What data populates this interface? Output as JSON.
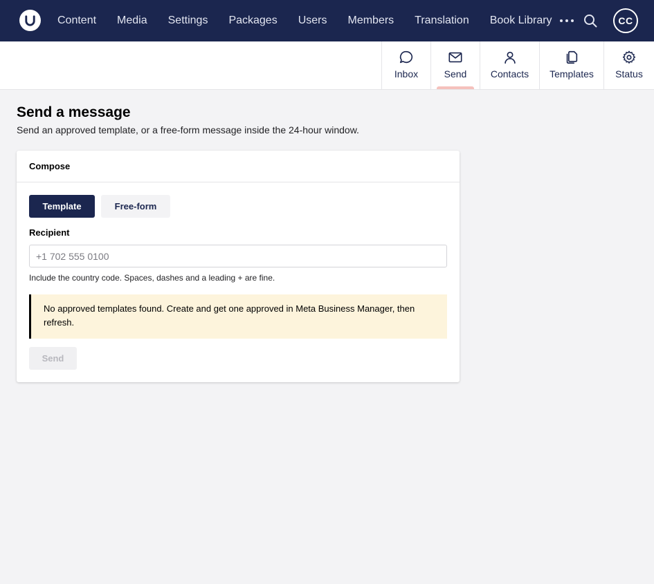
{
  "topnav": {
    "items": [
      "Content",
      "Media",
      "Settings",
      "Packages",
      "Users",
      "Members",
      "Translation",
      "Book Library"
    ],
    "avatar_initials": "CC",
    "icons": {
      "more": "ellipsis-icon",
      "search": "search-icon",
      "logo": "umbraco-logo-icon"
    }
  },
  "subtabs": [
    {
      "label": "Inbox",
      "icon": "chat-bubble-icon"
    },
    {
      "label": "Send",
      "icon": "envelope-icon",
      "active": true
    },
    {
      "label": "Contacts",
      "icon": "person-icon"
    },
    {
      "label": "Templates",
      "icon": "documents-icon"
    },
    {
      "label": "Status",
      "icon": "gear-icon"
    }
  ],
  "page": {
    "title": "Send a message",
    "subtitle": "Send an approved template, or a free-form message inside the 24-hour window."
  },
  "compose": {
    "header": "Compose",
    "mode_template": "Template",
    "mode_freeform": "Free-form",
    "recipient_label": "Recipient",
    "recipient_placeholder": "+1 702 555 0100",
    "recipient_value": "",
    "recipient_help": "Include the country code. Spaces, dashes and a leading + are fine.",
    "warning": "No approved templates found. Create and get one approved in Meta Business Manager, then refresh.",
    "send_label": "Send"
  },
  "colors": {
    "nav_bg": "#1b264f",
    "page_bg": "#f3f3f5",
    "active_tab_indicator": "#f5c1bc",
    "warning_bg": "#fdf4dc"
  }
}
